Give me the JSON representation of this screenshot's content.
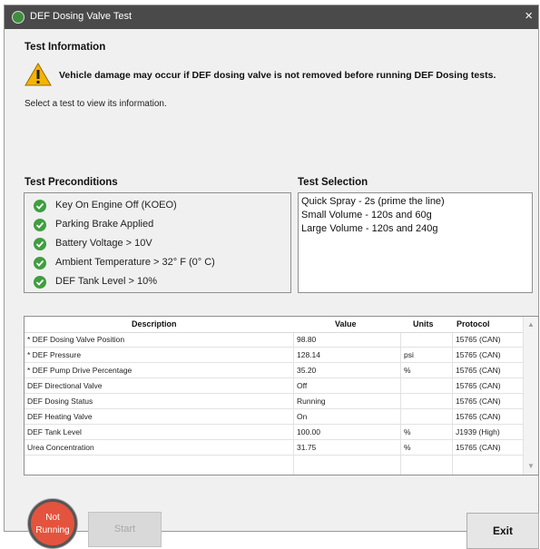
{
  "window": {
    "title": "DEF Dosing Valve Test",
    "close_label": "×"
  },
  "test_info": {
    "heading": "Test Information",
    "warning": "Vehicle damage may occur if DEF dosing valve is not removed before running DEF Dosing tests.",
    "hint": "Select a test to view its information."
  },
  "preconditions": {
    "heading": "Test Preconditions",
    "items": [
      "Key On Engine Off (KOEO)",
      "Parking Brake Applied",
      "Battery Voltage > 10V",
      "Ambient Temperature > 32° F (0° C)",
      "DEF Tank Level > 10%"
    ]
  },
  "test_selection": {
    "heading": "Test Selection",
    "items": [
      "Quick Spray - 2s (prime the line)",
      "Small Volume - 120s and 60g",
      "Large Volume - 120s and 240g"
    ]
  },
  "table": {
    "columns": [
      "Description",
      "Value",
      "Units",
      "Protocol"
    ],
    "rows": [
      [
        "* DEF Dosing Valve Position",
        "98.80",
        "",
        "15765 (CAN)"
      ],
      [
        "* DEF Pressure",
        "128.14",
        "psi",
        "15765 (CAN)"
      ],
      [
        "* DEF Pump Drive Percentage",
        "35.20",
        "%",
        "15765 (CAN)"
      ],
      [
        "DEF Directional Valve",
        "Off",
        "",
        "15765 (CAN)"
      ],
      [
        "DEF Dosing Status",
        "Running",
        "",
        "15765 (CAN)"
      ],
      [
        "DEF Heating Valve",
        "On",
        "",
        "15765 (CAN)"
      ],
      [
        "DEF Tank Level",
        "100.00",
        "%",
        "J1939 (High)"
      ],
      [
        "Urea Concentration",
        "31.75",
        "%",
        "15765 (CAN)"
      ]
    ]
  },
  "status": {
    "line1": "Not",
    "line2": "Running",
    "color": "#e4533d"
  },
  "buttons": {
    "start": "Start",
    "exit": "Exit"
  },
  "colors": {
    "titlebar": "#4a4a4a",
    "check": "#3f9e3f",
    "warning": "#f4b400"
  }
}
